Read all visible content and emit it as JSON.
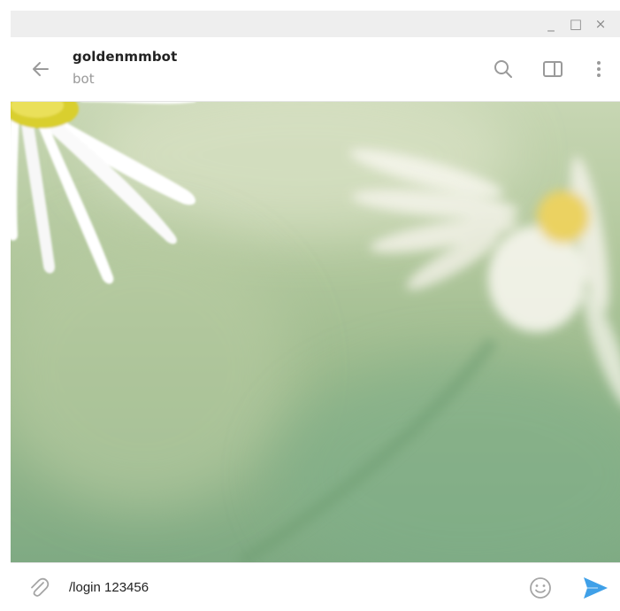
{
  "window": {
    "minimize_glyph": "_",
    "maximize_glyph": "□",
    "close_glyph": "×"
  },
  "header": {
    "title": "goldenmmbot",
    "status": "bot",
    "icons": [
      "back-arrow-icon",
      "search-icon",
      "sidebar-toggle-icon",
      "more-vertical-icon"
    ]
  },
  "chat": {
    "background": "daisy-flower-wallpaper",
    "messages": []
  },
  "composer": {
    "input_value": "/login 123456",
    "icons": [
      "paperclip-icon",
      "emoji-icon",
      "send-icon"
    ]
  },
  "colors": {
    "accent": "#3fa0e8",
    "icon_gray": "#9a9a9a",
    "title_text": "#222222",
    "status_text": "#999999"
  }
}
